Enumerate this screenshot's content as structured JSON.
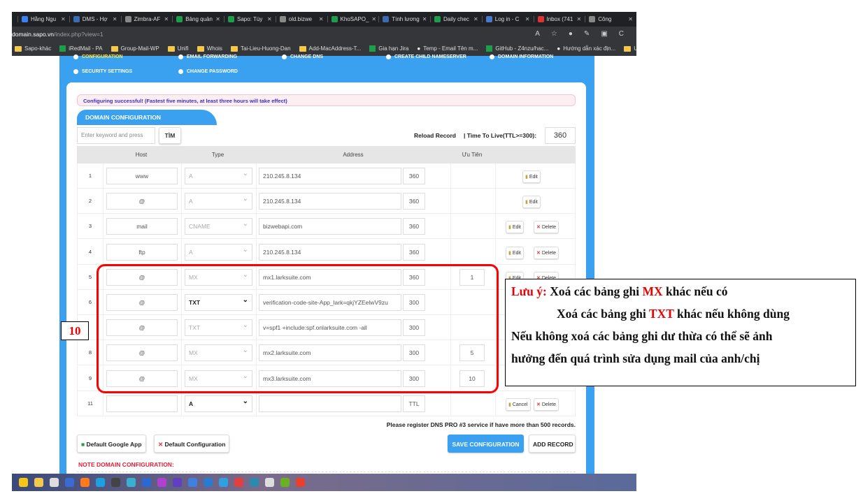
{
  "browser": {
    "tabs": [
      "Hằng Ngu",
      "DMS - Hợ",
      "Zimbra-AF",
      "Bảng quản",
      "Sapo: Tùy",
      "old.bizwe",
      "KhoSAPO_",
      "Tính lương",
      "Daily chec",
      "Log in - C",
      "Inbox (741",
      "Công"
    ],
    "url_host": "domain.sapo.vn",
    "url_path": "/index.php?view=1",
    "bookmarks": [
      "Sapo-khác",
      "iRedMail - PA",
      "Group-Mail-WP",
      "Unifi",
      "Whois",
      "Tai-Lieu-Huong-Dan",
      "Add-MacAddress-T...",
      "Gia hạn Jira",
      "Temp - Email Tên m...",
      "GitHub - Z4nzu/hac...",
      "Hướng dẫn xác địn...",
      "User_Downlo"
    ]
  },
  "nav": [
    "Configuration",
    "Email forwarding",
    "Change DNS",
    "Create child nameserver",
    "Domain information",
    "Security settings",
    "Change password"
  ],
  "alert": "Configuring successful! (Fastest five minutes, at least three hours will take effect)",
  "section_title": "DOMAIN CONFIGURATION",
  "search": {
    "placeholder": "Enter keyword and press",
    "button": "TÌM"
  },
  "reload": "Reload Record",
  "ttl_label": "| Time To Live(TTL>=300):",
  "ttl_value": "360",
  "columns": {
    "host": "Host",
    "type": "Type",
    "address": "Address",
    "priority": "Ưu Tiên"
  },
  "rows": [
    {
      "n": "1",
      "host": "www",
      "type": "A",
      "address": "210.245.8.134",
      "ttl": "360",
      "pri": "",
      "edit": "Edit",
      "delete": ""
    },
    {
      "n": "2",
      "host": "@",
      "type": "A",
      "address": "210.245.8.134",
      "ttl": "360",
      "pri": "",
      "edit": "Edit",
      "delete": ""
    },
    {
      "n": "3",
      "host": "mail",
      "type": "CNAME",
      "address": "bizwebapi.com",
      "ttl": "360",
      "pri": "",
      "edit": "Edit",
      "delete": "Delete"
    },
    {
      "n": "4",
      "host": "ftp",
      "type": "A",
      "address": "210.245.8.134",
      "ttl": "360",
      "pri": "",
      "edit": "Edit",
      "delete": "Delete"
    },
    {
      "n": "5",
      "host": "@",
      "type": "MX",
      "address": "mx1.larksuite.com",
      "ttl": "360",
      "pri": "1",
      "edit": "Edit",
      "delete": "Delete"
    },
    {
      "n": "6",
      "host": "@",
      "type": "TXT",
      "address": "verification-code-site-App_lark=qkjYZEelwV9zu",
      "ttl": "300",
      "pri": "",
      "edit": "",
      "delete": "",
      "active": true
    },
    {
      "n": "",
      "host": "@",
      "type": "TXT",
      "address": "v=spf1 +include:spf.onlarksuite.com -all",
      "ttl": "300",
      "pri": "",
      "edit": "",
      "delete": ""
    },
    {
      "n": "8",
      "host": "@",
      "type": "MX",
      "address": "mx2.larksuite.com",
      "ttl": "300",
      "pri": "5",
      "edit": "",
      "delete": ""
    },
    {
      "n": "9",
      "host": "@",
      "type": "MX",
      "address": "mx3.larksuite.com",
      "ttl": "300",
      "pri": "10",
      "edit": "",
      "delete": ""
    },
    {
      "n": "11",
      "host": "",
      "type": "A",
      "address": "",
      "ttl": "TTL",
      "pri": "",
      "edit": "Cancel",
      "delete": "Delete",
      "active": true
    }
  ],
  "footnote": "Please register DNS PRO #3 service if have more than 500 records.",
  "buttons": {
    "google": "Default Google App",
    "default": "Default Configuration",
    "save": "SAVE CONFIGURATION",
    "add": "ADD RECORD"
  },
  "note_heading": "NOTE DOMAIN CONFIGURATION:",
  "annotation": {
    "step": "10",
    "l1a": "Lưu ý:",
    "l1b": " Xoá các bảng ghi ",
    "l1c": "MX",
    "l1d": " khác nếu có",
    "l2a": "Xoá các bảng ghi ",
    "l2b": "TXT",
    "l2c": " khác nếu không dùng",
    "l3": "Nếu không xoá các bảng ghi dư thừa có thể sẽ ảnh",
    "l4": "hưởng đến quá trình sửa dụng mail của anh/chị"
  }
}
